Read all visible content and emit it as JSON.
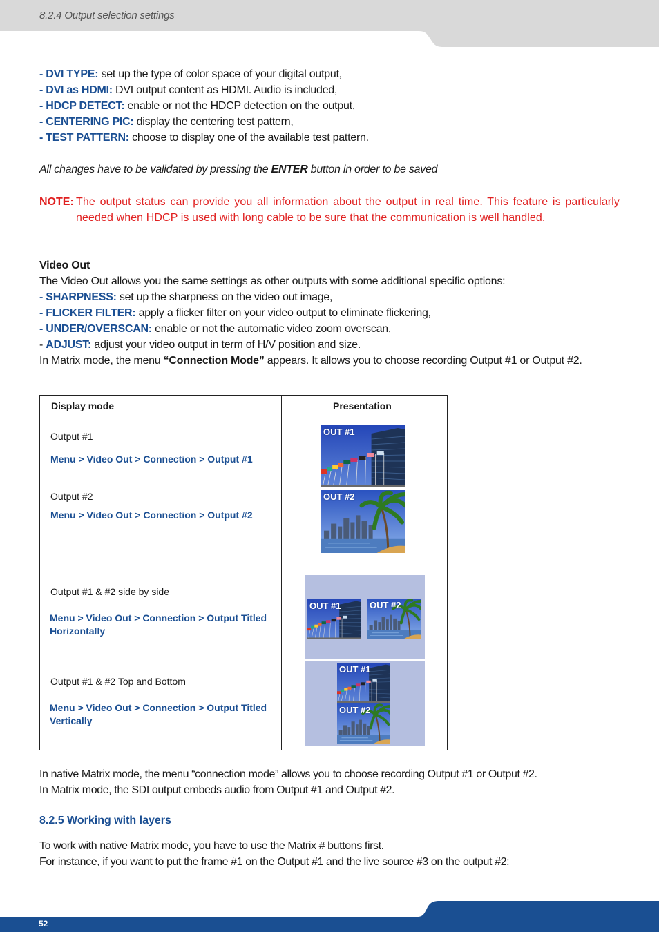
{
  "header": {
    "section_title": "8.2.4 Output selection settings"
  },
  "colors": {
    "accent_blue": "#1b4f93",
    "note_red": "#e02020",
    "header_gray": "#d9d9d9",
    "footer_blue": "#1a4f92",
    "panel_lavender": "#b5bfe0"
  },
  "output_options": [
    {
      "dash": "- ",
      "keyword": "DVI TYPE:",
      "text": " set up the type of color space of your digital output,"
    },
    {
      "dash": "- ",
      "keyword": "DVI as HDMI:",
      "text": " DVI output content as HDMI. Audio is included,"
    },
    {
      "dash": "- ",
      "keyword": "HDCP DETECT:",
      "text": " enable or not the HDCP detection on the output,"
    },
    {
      "dash": "- ",
      "keyword": "CENTERING PIC:",
      "text": " display the centering test pattern,"
    },
    {
      "dash": "- ",
      "keyword": "TEST PATTERN:",
      "text": " choose to display one of the available test pattern."
    }
  ],
  "validation": {
    "before": "All changes have to be validated by pressing the ",
    "key": "ENTER",
    "after": " button in order to be saved"
  },
  "note": {
    "label": "NOTE:",
    "text": "The output status can provide you all information about the output in real time. This feature is particularly needed when HDCP is used with long cable to be sure that the communication is well handled."
  },
  "video_out": {
    "title": "Video Out",
    "intro": "The Video Out allows you the same settings as other outputs with some additional specific options:",
    "options": [
      {
        "dash": "- ",
        "keyword": "SHARPNESS:",
        "text": " set up the sharpness on the video out image,"
      },
      {
        "dash": "- ",
        "keyword": "FLICKER FILTER:",
        "text": " apply a flicker filter on your video output to eliminate flickering,"
      },
      {
        "dash": "- ",
        "keyword": "UNDER/OVERSCAN:",
        "text": " enable or not the automatic video zoom overscan,"
      },
      {
        "dash": "- ",
        "keyword": "ADJUST:",
        "text": " adjust your video output in term of H/V position and size."
      }
    ],
    "matrix_before": "In Matrix mode, the menu ",
    "matrix_key": "“Connection Mode”",
    "matrix_after": " appears. It allows you to choose recording Output #1 or Output #2."
  },
  "table": {
    "headers": {
      "display_mode": "Display mode",
      "presentation": "Presentation"
    },
    "rows": [
      {
        "mode": "Output #1",
        "path": "Menu > Video Out > Connection > Output #1"
      },
      {
        "mode": "Output #2",
        "path": "Menu > Video Out > Connection > Output #2"
      },
      {
        "mode": "Output #1 & #2 side by side",
        "path": "Menu > Video Out > Connection > Output Titled Horizontally"
      },
      {
        "mode": "Output #1 & #2 Top and Bottom",
        "path": "Menu > Video Out > Connection > Output Titled Vertically"
      }
    ],
    "thumb_labels": {
      "out1": "OUT #1",
      "out2": "OUT #2"
    }
  },
  "after_table": {
    "line1": "In native Matrix mode, the menu “connection mode” allows you to choose recording Output #1 or Output #2.",
    "line2": "In Matrix mode, the SDI output embeds audio from Output #1 and Output #2."
  },
  "section_825": {
    "title": "8.2.5 Working with layers",
    "line1": "To work with native Matrix mode, you have to use the Matrix # buttons first.",
    "line2": "For instance, if you want to put the frame #1 on the Output #1 and the live source #3 on the output #2:"
  },
  "footer": {
    "page_number": "52"
  }
}
